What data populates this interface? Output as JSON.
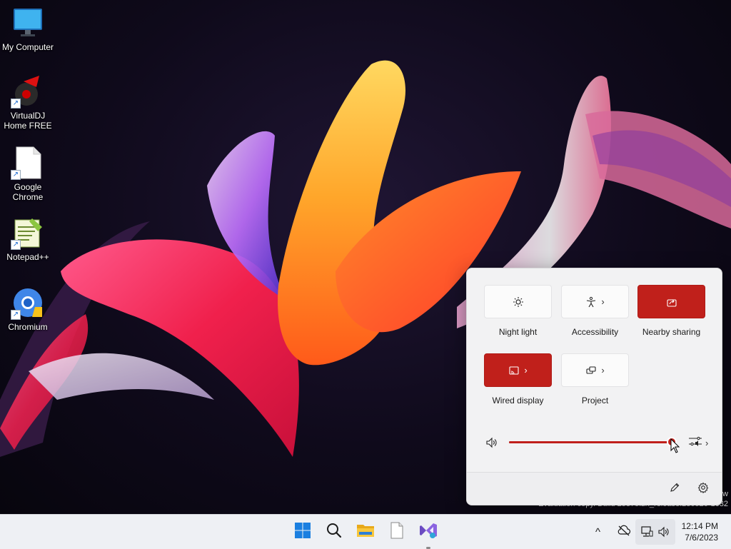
{
  "desktop": {
    "icons": [
      {
        "label": "My Computer",
        "icon": "monitor-icon"
      },
      {
        "label": "VirtualDJ\nHome FREE",
        "icon": "virtualdj-icon"
      },
      {
        "label": "Google\nChrome",
        "icon": "blank-file-icon"
      },
      {
        "label": "Notepad++",
        "icon": "notepadpp-icon"
      },
      {
        "label": "Chromium",
        "icon": "chromium-icon"
      }
    ],
    "watermark_edge": "w",
    "watermark": "Evaluation copy. Build 25375.zn_release.230520-1632"
  },
  "quick_settings": {
    "tiles": [
      {
        "label": "Night light",
        "icon": "brightness-icon",
        "active": false,
        "has_chevron": false
      },
      {
        "label": "Accessibility",
        "icon": "accessibility-icon",
        "active": false,
        "has_chevron": true
      },
      {
        "label": "Nearby sharing",
        "icon": "share-icon",
        "active": true,
        "has_chevron": false
      },
      {
        "label": "Wired display",
        "icon": "cast-icon",
        "active": true,
        "has_chevron": true
      },
      {
        "label": "Project",
        "icon": "project-icon",
        "active": false,
        "has_chevron": true
      }
    ],
    "volume_percent": 99,
    "chevron": "›",
    "accent_color": "#c0201b"
  },
  "taskbar": {
    "apps": [
      "start-icon",
      "search-icon",
      "file-explorer-icon",
      "notepad-icon",
      "visual-studio-icon"
    ],
    "tray": {
      "expand": "^",
      "time": "12:14 PM",
      "date": "7/6/2023"
    }
  }
}
